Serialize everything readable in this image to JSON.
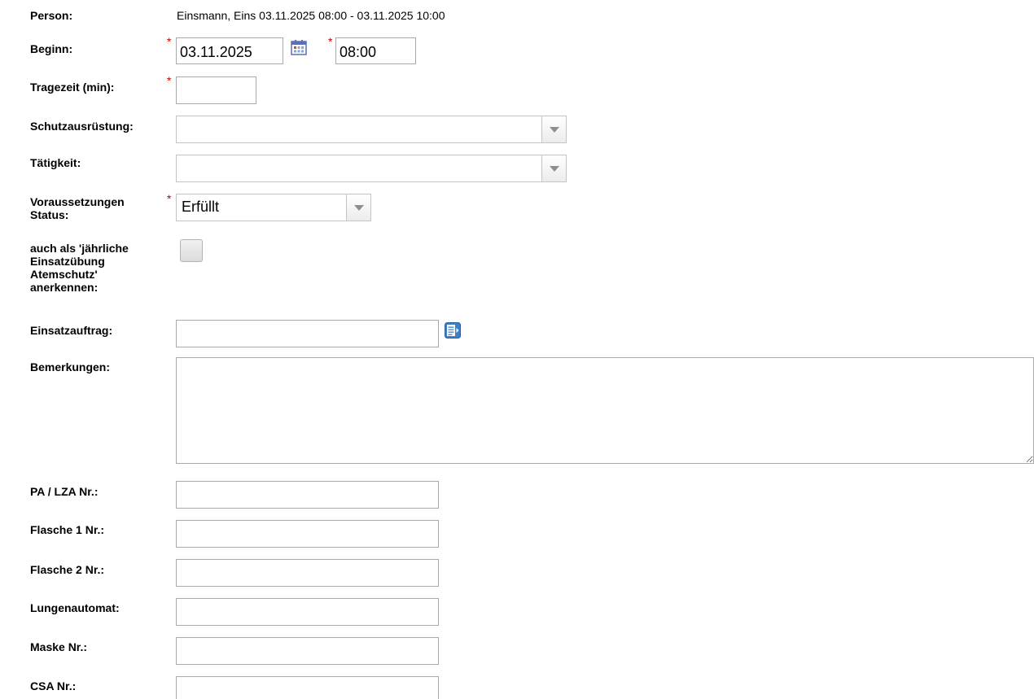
{
  "person": {
    "label": "Person:",
    "value": "Einsmann, Eins 03.11.2025 08:00 - 03.11.2025 10:00"
  },
  "beginn": {
    "label": "Beginn:",
    "date_value": "03.11.2025",
    "time_value": "08:00",
    "required_mark": "*"
  },
  "tragezeit": {
    "label": "Tragezeit (min):",
    "value": "",
    "required_mark": "*"
  },
  "schutzausruestung": {
    "label": "Schutzausrüstung:",
    "selected": ""
  },
  "taetigkeit": {
    "label": "Tätigkeit:",
    "selected": ""
  },
  "voraussetzungen": {
    "label_line1": "Voraussetzungen",
    "label_line2": "Status:",
    "selected": "Erfüllt",
    "required_mark": "*"
  },
  "jaehrliche": {
    "label_line1": "auch als 'jährliche",
    "label_line2": "Einsatzübung",
    "label_line3": "Atemschutz'",
    "label_line4": "anerkennen:",
    "checked": false
  },
  "einsatzauftrag": {
    "label": "Einsatzauftrag:",
    "value": ""
  },
  "bemerkungen": {
    "label": "Bemerkungen:",
    "value": ""
  },
  "pa_lza": {
    "label": "PA / LZA Nr.:",
    "value": ""
  },
  "flasche1": {
    "label": "Flasche 1 Nr.:",
    "value": ""
  },
  "flasche2": {
    "label": "Flasche 2 Nr.:",
    "value": ""
  },
  "lungenautomat": {
    "label": "Lungenautomat:",
    "value": ""
  },
  "maske": {
    "label": "Maske Nr.:",
    "value": ""
  },
  "csa": {
    "label": "CSA Nr.:",
    "value": ""
  },
  "icons": {
    "calendar": "calendar-icon",
    "lookup": "list-lookup-icon",
    "dropdown": "chevron-down-icon"
  },
  "colors": {
    "required": "#cc0000",
    "calendar_icon": "#5b6fb4",
    "lookup_icon": "#3d7fc9"
  }
}
